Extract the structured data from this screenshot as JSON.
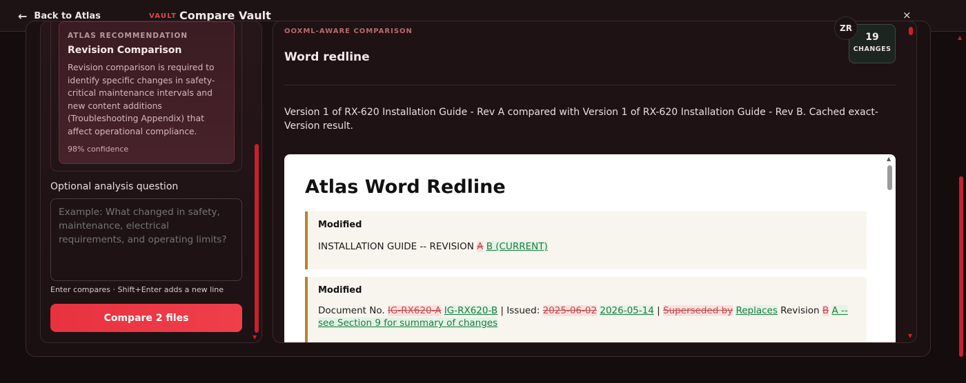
{
  "topbar": {
    "back_label": "Back to Atlas",
    "vault_tag": "VAULT",
    "title": "Compare Vault",
    "close_label": "×",
    "avatar_initials": "ZR"
  },
  "recommendation": {
    "label": "ATLAS RECOMMENDATION",
    "title": "Revision Comparison",
    "body": "Revision comparison is required to identify specific changes in safety-critical maintenance intervals and new content additions (Troubleshooting Appendix) that affect operational compliance.",
    "confidence": "98% confidence"
  },
  "question": {
    "label": "Optional analysis question",
    "placeholder": "Example: What changed in safety, maintenance, electrical requirements, and operating limits?",
    "hint": "Enter compares · Shift+Enter adds a new line",
    "compare_button": "Compare 2 files"
  },
  "result": {
    "kicker": "OOXML-AWARE COMPARISON",
    "title": "Word redline",
    "changes_count": "19",
    "changes_label": "CHANGES",
    "summary": "Version 1 of RX-620 Installation Guide - Rev A compared with Version 1 of RX-620 Installation Guide - Rev B. Cached exact-Version result."
  },
  "document": {
    "title": "Atlas Word Redline",
    "blocks": [
      {
        "heading": "Modified",
        "t1": "INSTALLATION GUIDE -- REVISION ",
        "del1": "A",
        "ins1": "B (CURRENT)"
      },
      {
        "heading": "Modified",
        "t1": "Document No. ",
        "del1": "IG-RX620-A",
        "ins1": "IG-RX620-B",
        "t2": " | Issued: ",
        "del2": "2025-06-02",
        "ins2": "2026-05-14",
        "t3": " | ",
        "del3": "Superseded by",
        "ins3": "Replaces",
        "t4": " Revision ",
        "del4": "B",
        "ins4": "A -- see Section 9 for summary of changes"
      }
    ]
  },
  "colors": {
    "accent": "#e8323f",
    "deletion_bg": "#fbe0df",
    "insertion_bg": "#e3f4e6",
    "block_border": "#b5852f"
  }
}
